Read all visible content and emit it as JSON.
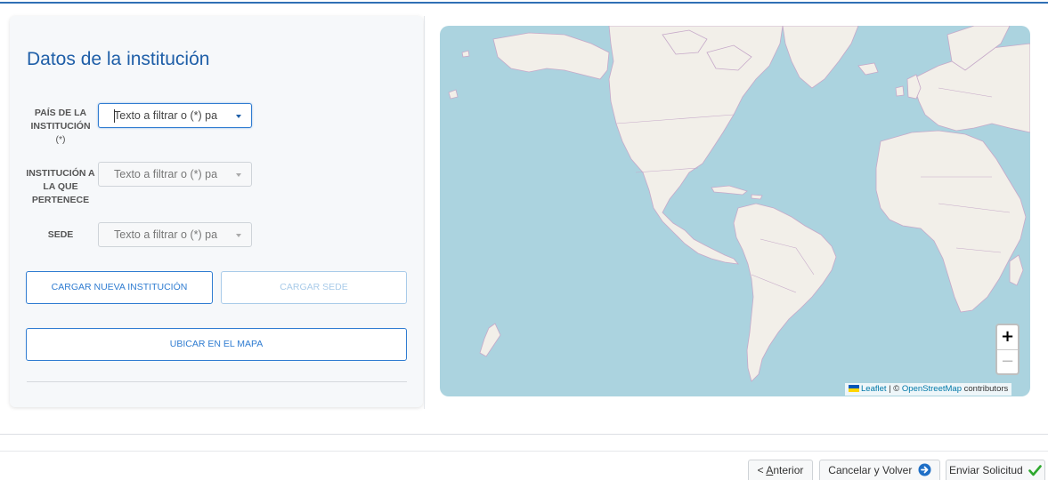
{
  "form": {
    "title": "Datos de la institución",
    "fields": [
      {
        "label": "PAÍS DE LA INSTITUCIÓN",
        "required": "(*)",
        "placeholder": "Texto a filtrar o (*) pa"
      },
      {
        "label": "INSTITUCIÓN A LA QUE PERTENECE",
        "required": "",
        "placeholder": "Texto a filtrar o (*) pa"
      },
      {
        "label": "SEDE",
        "required": "",
        "placeholder": "Texto a filtrar o (*) pa"
      }
    ],
    "buttons": {
      "new_institution": "CARGAR NUEVA INSTITUCIÓN",
      "load_site": "CARGAR SEDE",
      "locate_map": "UBICAR EN EL MAPA"
    }
  },
  "map": {
    "zoom_in": "+",
    "zoom_out": "−",
    "attribution": {
      "leaflet": "Leaflet",
      "separator": " | © ",
      "osm": "OpenStreetMap",
      "suffix": " contributors"
    },
    "colors": {
      "water": "#abd3df",
      "land": "#f2efe9",
      "borders": "#c6a9c9"
    }
  },
  "footer": {
    "prev_prefix": "< ",
    "prev_key": "A",
    "prev_rest": "nterior",
    "cancel": "Cancelar y Volver",
    "send": "Enviar Solicitud",
    "cancel_icon": "circle-arrow-icon",
    "send_icon": "checkmark-icon"
  }
}
